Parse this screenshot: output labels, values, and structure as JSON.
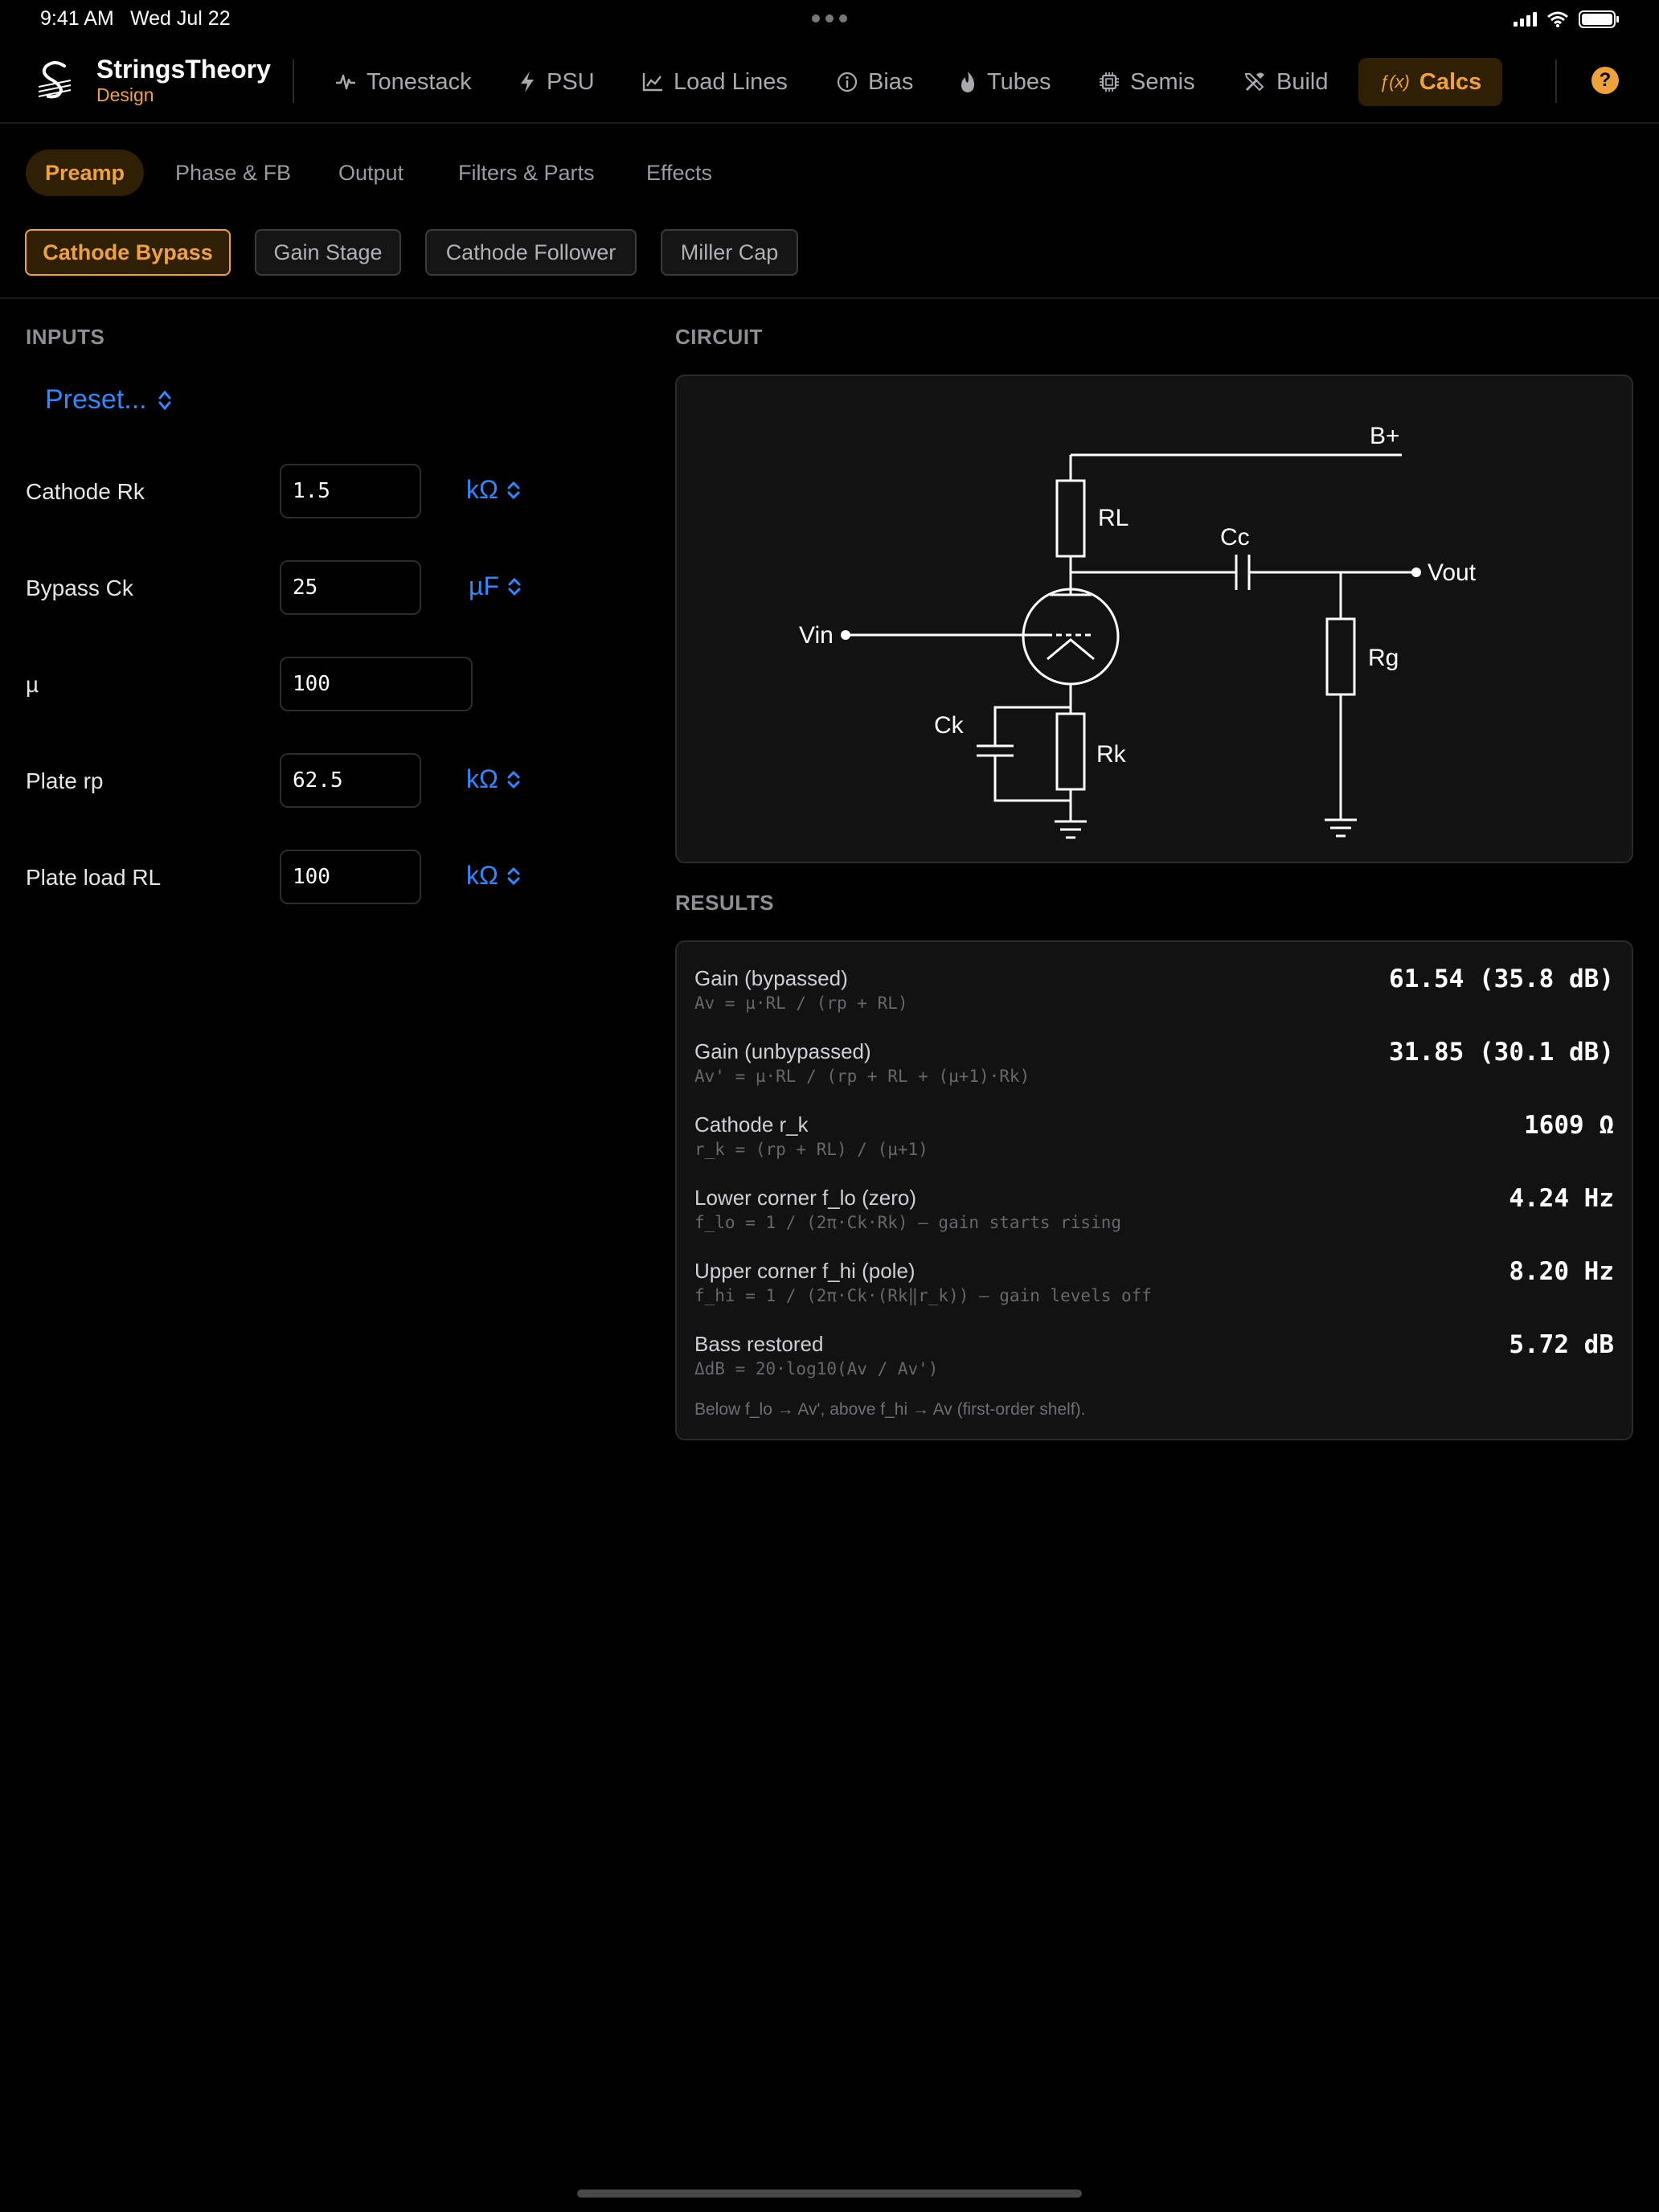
{
  "status": {
    "time": "9:41 AM",
    "date": "Wed Jul 22"
  },
  "brand": {
    "name": "StringsTheory",
    "sub": "Design"
  },
  "nav": {
    "tonestack": "Tonestack",
    "psu": "PSU",
    "loadlines": "Load Lines",
    "bias": "Bias",
    "tubes": "Tubes",
    "semis": "Semis",
    "build": "Build",
    "calcs_icon": "ƒ(x)",
    "calcs": "Calcs",
    "help": "?"
  },
  "subtabs": {
    "preamp": "Preamp",
    "phase": "Phase & FB",
    "output": "Output",
    "filters": "Filters & Parts",
    "effects": "Effects"
  },
  "chips": {
    "cathode_bypass": "Cathode Bypass",
    "gain_stage": "Gain Stage",
    "cathode_follower": "Cathode Follower",
    "miller_cap": "Miller Cap"
  },
  "inputs": {
    "title": "INPUTS",
    "preset": "Preset...",
    "rk": {
      "label": "Cathode Rk",
      "value": "1.5",
      "unit": "kΩ"
    },
    "ck": {
      "label": "Bypass Ck",
      "value": "25",
      "unit": "µF"
    },
    "mu": {
      "label": "µ",
      "value": "100"
    },
    "rp": {
      "label": "Plate rp",
      "value": "62.5",
      "unit": "kΩ"
    },
    "rl": {
      "label": "Plate load RL",
      "value": "100",
      "unit": "kΩ"
    }
  },
  "circuit": {
    "title": "CIRCUIT",
    "labels": {
      "bplus": "B+",
      "rl": "RL",
      "cc": "Cc",
      "vout": "Vout",
      "vin": "Vin",
      "rg": "Rg",
      "ck": "Ck",
      "rk": "Rk"
    }
  },
  "results": {
    "title": "RESULTS",
    "gain_bypassed": {
      "name": "Gain (bypassed)",
      "formula": "Av = µ·RL / (rp + RL)",
      "value": "61.54 (35.8 dB)"
    },
    "gain_unbypassed": {
      "name": "Gain (unbypassed)",
      "formula": "Av' = µ·RL / (rp + RL + (µ+1)·Rk)",
      "value": "31.85 (30.1 dB)"
    },
    "cathode_rk": {
      "name": "Cathode r_k",
      "formula": "r_k = (rp + RL) / (µ+1)",
      "value": "1609 Ω"
    },
    "f_lo": {
      "name": "Lower corner f_lo (zero)",
      "formula": "f_lo = 1 / (2π·Ck·Rk) — gain starts rising",
      "value": "4.24 Hz"
    },
    "f_hi": {
      "name": "Upper corner f_hi (pole)",
      "formula": "f_hi = 1 / (2π·Ck·(Rk‖r_k)) — gain levels off",
      "value": "8.20 Hz"
    },
    "bass": {
      "name": "Bass restored",
      "formula": "ΔdB = 20·log10(Av / Av')",
      "value": "5.72 dB"
    },
    "note": "Below f_lo → Av', above f_hi → Av (first-order shelf)."
  }
}
